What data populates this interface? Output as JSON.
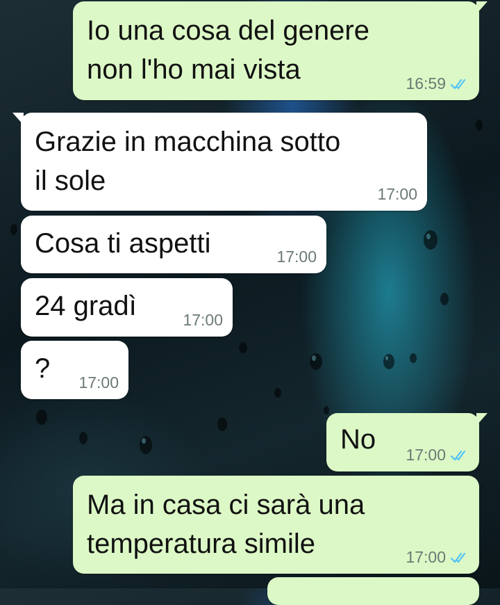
{
  "theme": {
    "outgoing_bubble": "#dcf8c6",
    "incoming_bubble": "#ffffff",
    "read_tick_color": "#4fc3f7"
  },
  "messages": [
    {
      "direction": "outgoing",
      "text": "Io una cosa del genere\nnon l'ho mai vista",
      "time": "16:59",
      "status": "read"
    },
    {
      "direction": "incoming",
      "text": "Grazie in macchina sotto\nil sole",
      "time": "17:00"
    },
    {
      "direction": "incoming",
      "text": "Cosa ti aspetti",
      "time": "17:00"
    },
    {
      "direction": "incoming",
      "text": "24 gradì",
      "time": "17:00"
    },
    {
      "direction": "incoming",
      "text": "?",
      "time": "17:00"
    },
    {
      "direction": "outgoing",
      "text": "No",
      "time": "17:00",
      "status": "read"
    },
    {
      "direction": "outgoing",
      "text": "Ma in casa ci sarà una\ntemperatura simile",
      "time": "17:00",
      "status": "read"
    }
  ]
}
